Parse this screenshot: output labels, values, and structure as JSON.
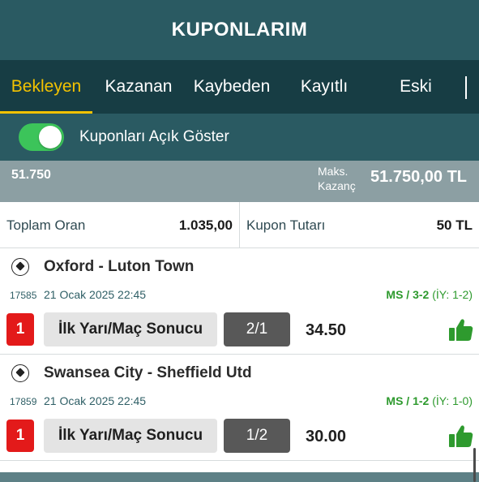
{
  "header": {
    "title": "KUPONLARIM"
  },
  "tabs": [
    {
      "label": "Bekleyen",
      "active": true
    },
    {
      "label": "Kazanan",
      "active": false
    },
    {
      "label": "Kaybeden",
      "active": false
    },
    {
      "label": "Kayıtlı",
      "active": false
    },
    {
      "label": "Eski",
      "active": false
    }
  ],
  "toggle": {
    "label": "Kuponları Açık Göster",
    "on": true
  },
  "summary": {
    "left_value": "51.750",
    "maks_label_line1": "Maks.",
    "maks_label_line2": "Kazanç",
    "maks_value": "51.750,00 TL"
  },
  "totals": {
    "toplam_oran_label": "Toplam Oran",
    "toplam_oran_value": "1.035,00",
    "kupon_tutari_label": "Kupon Tutarı",
    "kupon_tutari_value": "50 TL"
  },
  "matches": [
    {
      "teams": "Oxford - Luton Town",
      "code": "17585",
      "datetime": "21 Ocak 2025 22:45",
      "result_ms": "MS / 3-2",
      "result_iy": "(İY: 1-2)",
      "badge": "1",
      "bet_type": "İlk Yarı/Maç Sonucu",
      "pick": "2/1",
      "odds": "34.50",
      "status_icon": "thumbs-up-icon"
    },
    {
      "teams": "Swansea City - Sheffield Utd",
      "code": "17859",
      "datetime": "21 Ocak 2025 22:45",
      "result_ms": "MS / 1-2",
      "result_iy": "(İY: 1-0)",
      "badge": "1",
      "bet_type": "İlk Yarı/Maç Sonucu",
      "pick": "1/2",
      "odds": "30.00",
      "status_icon": "thumbs-up-icon"
    }
  ],
  "colors": {
    "header_bg": "#2a5a62",
    "tabs_bg": "#173d44",
    "active_tab": "#f3c200",
    "toggle_on": "#3cc45a",
    "summary_bg": "#8c9fa3",
    "badge_red": "#e31a1a",
    "win_green": "#2e9a2e"
  }
}
